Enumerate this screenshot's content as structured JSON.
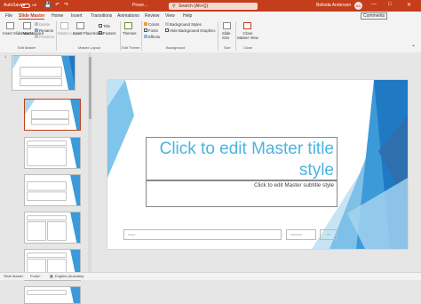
{
  "titlebar": {
    "autosave_label": "AutoSave",
    "autosave_state": "Off",
    "doc_title": "Prese...",
    "search_placeholder": "Search (Alt+Q)",
    "user_name": "Belinda Anderson",
    "user_initials": "BA",
    "bg_color": "#c43e1c"
  },
  "tabs": [
    "File",
    "Slide Master",
    "Home",
    "Insert",
    "Transitions",
    "Animations",
    "Review",
    "View",
    "Help"
  ],
  "active_tab": "Slide Master",
  "share_buttons": {
    "comments": "Comments"
  },
  "ribbon": {
    "edit_master": {
      "insert_slide_master": "Insert Slide Master",
      "insert_layout": "Insert Layout",
      "delete": "Delete",
      "rename": "Rename",
      "preserve": "Preserve",
      "label": "Edit Master"
    },
    "master_layout": {
      "master_layout": "Master Layout",
      "insert_placeholder": "Insert Placeholder",
      "title": "Title",
      "footers": "Footers",
      "label": "Master Layout"
    },
    "edit_theme": {
      "themes": "Themes",
      "label": "Edit Theme"
    },
    "background": {
      "colors": "Colors",
      "fonts": "Fonts",
      "effects": "Effects",
      "background_styles": "Background Styles",
      "hide_background_graphics": "Hide Background Graphics",
      "label": "Background"
    },
    "size": {
      "slide_size": "Slide Size",
      "label": "Size"
    },
    "close": {
      "close_master_view": "Close Master View",
      "label": "Close"
    }
  },
  "thumbnails": {
    "master_number": "1"
  },
  "slide": {
    "title": "Click to edit Master title style",
    "subtitle": "Click to edit Master subtitle style",
    "footer": "Footer",
    "date": "9/10/2021",
    "number": "<#>",
    "accent": "#1f8fd6"
  },
  "statusbar": {
    "view": "Slide Master",
    "accessibility": "Fonts*",
    "language": "English (Australia)"
  }
}
